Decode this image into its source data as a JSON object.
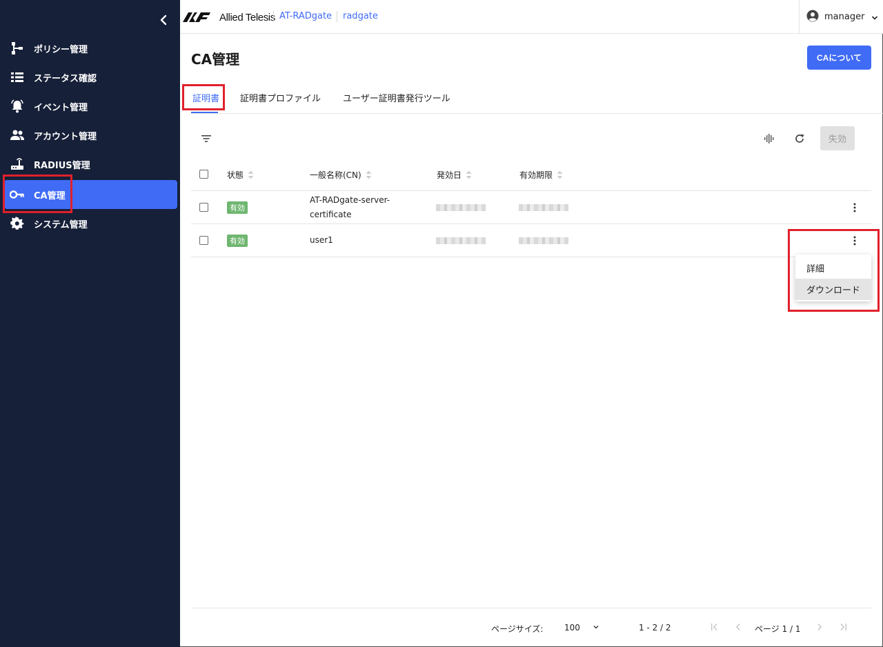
{
  "sidebar": {
    "collapse_icon": "chevron-left-icon",
    "items": [
      {
        "label": "ポリシー管理",
        "icon": "policy-tree-icon",
        "active": false
      },
      {
        "label": "ステータス確認",
        "icon": "list-icon",
        "active": false
      },
      {
        "label": "イベント管理",
        "icon": "alarm-icon",
        "active": false
      },
      {
        "label": "アカウント管理",
        "icon": "people-icon",
        "active": false
      },
      {
        "label": "RADIUS管理",
        "icon": "router-icon",
        "active": false
      },
      {
        "label": "CA管理",
        "icon": "key-icon",
        "active": true
      },
      {
        "label": "システム管理",
        "icon": "gear-icon",
        "active": false
      }
    ]
  },
  "header": {
    "brand": "Allied Telesis",
    "breadcrumb": [
      "AT-RADgate",
      "radgate"
    ],
    "user": "manager"
  },
  "page": {
    "title": "CA管理",
    "about_button": "CAについて"
  },
  "tabs": [
    {
      "label": "証明書",
      "active": true
    },
    {
      "label": "証明書プロファイル",
      "active": false
    },
    {
      "label": "ユーザー証明書発行ツール",
      "active": false
    }
  ],
  "toolbar": {
    "revoke_label": "失効"
  },
  "table": {
    "columns": [
      "状態",
      "一般名称(CN)",
      "発効日",
      "有効期限"
    ],
    "rows": [
      {
        "status": "有効",
        "cn_line1": "AT-RADgate-server-",
        "cn_line2": "certificate"
      },
      {
        "status": "有効",
        "cn_line1": "user1",
        "cn_line2": ""
      }
    ]
  },
  "context_menu": {
    "items": [
      "詳細",
      "ダウンロード"
    ],
    "hovered_index": 1
  },
  "pagination": {
    "page_size_label": "ページサイズ:",
    "page_size": "100",
    "range": "1 - 2 / 2",
    "page_label": "ページ 1 / 1"
  },
  "colors": {
    "sidebar_bg": "#162038",
    "accent": "#3f6bf5",
    "status_green": "#6fb670",
    "highlight_red": "#e0202b"
  }
}
